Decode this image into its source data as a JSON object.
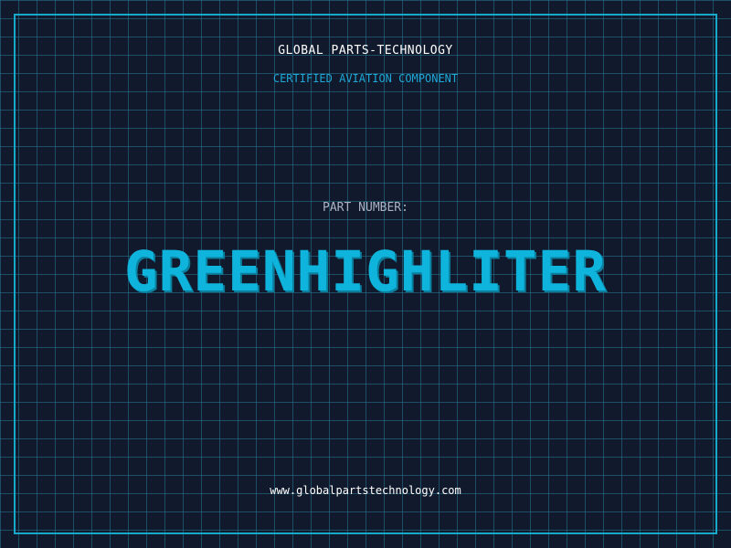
{
  "brand": "GLOBAL PARTS-TECHNOLOGY",
  "subtitle": "CERTIFIED AVIATION COMPONENT",
  "part_label": "PART NUMBER:",
  "part_number": "GREENHIGHLITER",
  "website": "www.globalpartstechnology.com",
  "colors": {
    "background": "#111a2d",
    "grid": "#287896",
    "accent": "#0fb4dc",
    "border": "#17a9c9",
    "text": "#ffffff",
    "muted": "#aab3c2"
  }
}
